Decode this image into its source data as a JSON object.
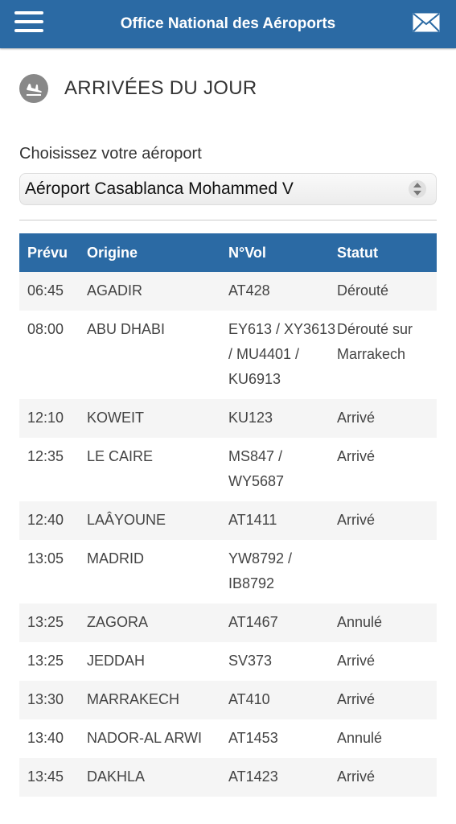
{
  "header": {
    "title": "Office National des Aéroports"
  },
  "section": {
    "title": "ARRIVÉES DU JOUR"
  },
  "airport": {
    "label": "Choisissez votre aéroport",
    "selected": "Aéroport Casablanca Mohammed V"
  },
  "table": {
    "headers": [
      "Prévu",
      "Origine",
      "N°Vol",
      "Statut"
    ],
    "rows": [
      {
        "time": "06:45",
        "origin": "AGADIR",
        "flight": "AT428",
        "status": "Dérouté"
      },
      {
        "time": "08:00",
        "origin": "ABU DHABI",
        "flight": "EY613 / XY3613 / MU4401 / KU6913",
        "status": "Dérouté sur Marrakech"
      },
      {
        "time": "12:10",
        "origin": "KOWEIT",
        "flight": "KU123",
        "status": "Arrivé"
      },
      {
        "time": "12:35",
        "origin": "LE CAIRE",
        "flight": "MS847 / WY5687",
        "status": "Arrivé"
      },
      {
        "time": "12:40",
        "origin": "LAÂYOUNE",
        "flight": "AT1411",
        "status": "Arrivé"
      },
      {
        "time": "13:05",
        "origin": "MADRID",
        "flight": "YW8792 / IB8792",
        "status": ""
      },
      {
        "time": "13:25",
        "origin": "ZAGORA",
        "flight": "AT1467",
        "status": "Annulé"
      },
      {
        "time": "13:25",
        "origin": "JEDDAH",
        "flight": "SV373",
        "status": "Arrivé"
      },
      {
        "time": "13:30",
        "origin": "MARRAKECH",
        "flight": "AT410",
        "status": "Arrivé"
      },
      {
        "time": "13:40",
        "origin": "NADOR-AL ARWI",
        "flight": "AT1453",
        "status": "Annulé"
      },
      {
        "time": "13:45",
        "origin": "DAKHLA",
        "flight": "AT1423",
        "status": "Arrivé"
      }
    ]
  }
}
